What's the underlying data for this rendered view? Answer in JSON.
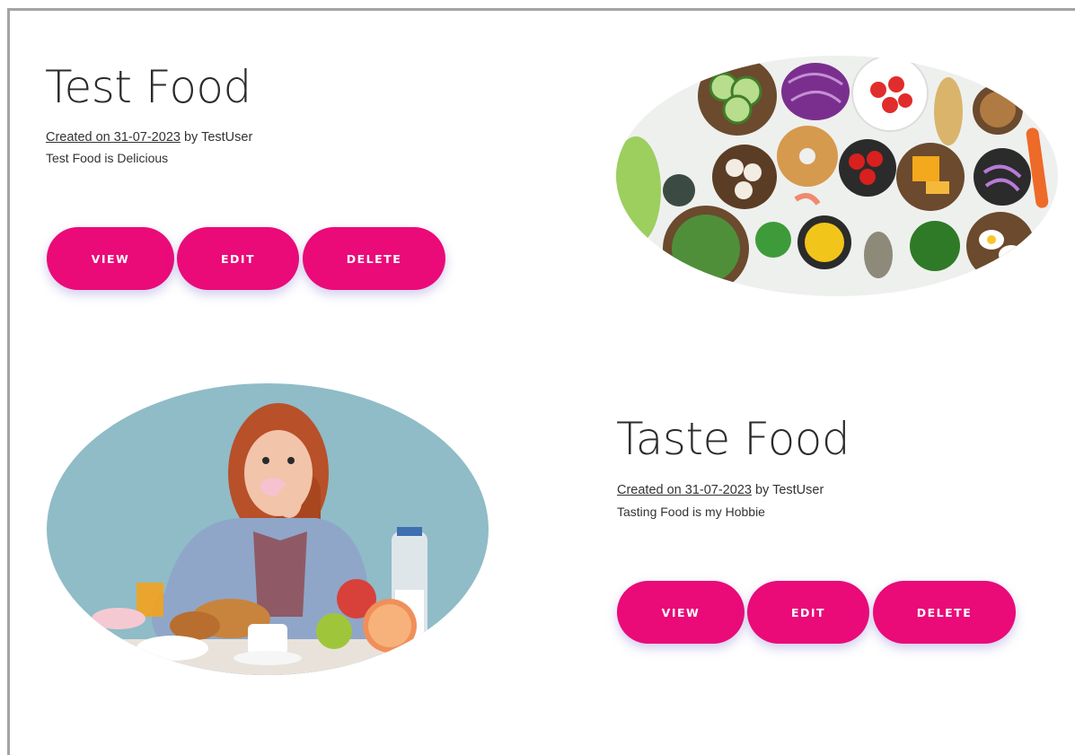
{
  "posts": [
    {
      "title": "Test Food",
      "created_link": "Created on 31-07-2023",
      "author_text": " by TestUser",
      "description": "Test Food is Delicious",
      "buttons": {
        "view": "VIEW",
        "edit": "EDIT",
        "delete": "DELETE"
      }
    },
    {
      "title": "Taste Food",
      "created_link": "Created on 31-07-2023",
      "author_text": " by TestUser",
      "description": "Tasting Food is my Hobbie",
      "buttons": {
        "view": "VIEW",
        "edit": "EDIT",
        "delete": "DELETE"
      }
    }
  ],
  "colors": {
    "accent": "#ea0a78",
    "frame_border": "#a4a4a4",
    "text": "#333333",
    "photo_bg_blue": "#8fbcc7",
    "photo_bg_white": "#eef0ee"
  }
}
